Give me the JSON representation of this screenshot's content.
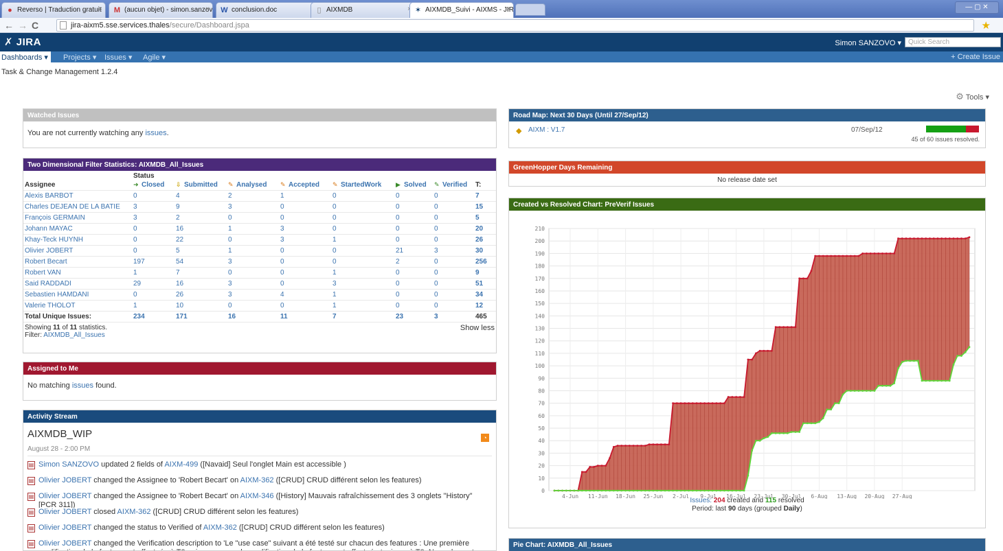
{
  "browser": {
    "tabs": [
      {
        "title": "Reverso | Traduction gratuit",
        "icon": "reverso-icon"
      },
      {
        "title": "(aucun objet) - simon.sanzov",
        "icon": "gmail-icon"
      },
      {
        "title": "conclusion.doc",
        "icon": "word-icon"
      },
      {
        "title": "AIXMDB",
        "icon": "page-icon"
      },
      {
        "title": "AIXMDB_Suivi - AIXMS - JIRA",
        "icon": "jira-icon"
      }
    ],
    "url_host": "jira-aixm5.sse.services.thales",
    "url_path": "/secure/Dashboard.jspa"
  },
  "header": {
    "logo": "JIRA",
    "user": "Simon SANZOVO",
    "search_placeholder": "Quick Search",
    "menu": {
      "dashboards": "Dashboards",
      "projects": "Projects",
      "issues": "Issues",
      "agile": "Agile"
    },
    "create": "+ Create Issue"
  },
  "dashboard": {
    "title": "Task & Change Management 1.2.4",
    "tools": "Tools"
  },
  "watched": {
    "title": "Watched Issues",
    "text_before": "You are not currently watching any",
    "link": "issues",
    "text_after": "."
  },
  "twodim": {
    "title": "Two Dimensional Filter Statistics: AIXMDB_All_Issues",
    "status_label": "Status",
    "assignee_label": "Assignee",
    "columns": [
      "Closed",
      "Submitted",
      "Analysed",
      "Accepted",
      "StartedWork",
      "Solved",
      "Verified",
      "T:"
    ],
    "rows": [
      {
        "name": "Alexis BARBOT",
        "v": [
          "0",
          "4",
          "2",
          "1",
          "0",
          "0",
          "0",
          "7"
        ]
      },
      {
        "name": "Charles DEJEAN DE LA BATIE",
        "v": [
          "3",
          "9",
          "3",
          "0",
          "0",
          "0",
          "0",
          "15"
        ]
      },
      {
        "name": "François GERMAIN",
        "v": [
          "3",
          "2",
          "0",
          "0",
          "0",
          "0",
          "0",
          "5"
        ]
      },
      {
        "name": "Johann MAYAC",
        "v": [
          "0",
          "16",
          "1",
          "3",
          "0",
          "0",
          "0",
          "20"
        ]
      },
      {
        "name": "Khay-Teck HUYNH",
        "v": [
          "0",
          "22",
          "0",
          "3",
          "1",
          "0",
          "0",
          "26"
        ]
      },
      {
        "name": "Olivier JOBERT",
        "v": [
          "0",
          "5",
          "1",
          "0",
          "0",
          "21",
          "3",
          "30"
        ]
      },
      {
        "name": "Robert Becart",
        "v": [
          "197",
          "54",
          "3",
          "0",
          "0",
          "2",
          "0",
          "256"
        ]
      },
      {
        "name": "Robert VAN",
        "v": [
          "1",
          "7",
          "0",
          "0",
          "1",
          "0",
          "0",
          "9"
        ]
      },
      {
        "name": "Said RADDADI",
        "v": [
          "29",
          "16",
          "3",
          "0",
          "3",
          "0",
          "0",
          "51"
        ]
      },
      {
        "name": "Sebastien HAMDANI",
        "v": [
          "0",
          "26",
          "3",
          "4",
          "1",
          "0",
          "0",
          "34"
        ]
      },
      {
        "name": "Valerie THOLOT",
        "v": [
          "1",
          "10",
          "0",
          "0",
          "1",
          "0",
          "0",
          "12"
        ]
      }
    ],
    "total": {
      "name": "Total Unique Issues:",
      "v": [
        "234",
        "171",
        "16",
        "11",
        "7",
        "23",
        "3",
        "465"
      ]
    },
    "showing_prefix": "Showing",
    "showing_count": "11",
    "showing_mid": "of",
    "showing_total": "11",
    "showing_suffix": "statistics.",
    "filter_label": "Filter:",
    "filter_link": "AIXMDB_All_Issues",
    "show_less": "Show less"
  },
  "assigned": {
    "title": "Assigned to Me",
    "text_before": "No matching",
    "link": "issues",
    "text_after": "found."
  },
  "activity": {
    "title": "Activity Stream",
    "project": "AIXMDB_WIP",
    "date": "August 28 - 2:00 PM",
    "items": [
      {
        "user": "Simon SANZOVO",
        "a": " updated 2 fields of ",
        "issue": "AIXM-499",
        "b": " ([Navaid] Seul l'onglet Main est accessible )"
      },
      {
        "user": "Olivier JOBERT",
        "a": " changed the Assignee to 'Robert Becart' on ",
        "issue": "AIXM-362",
        "b": " ([CRUD] CRUD différent selon les features)"
      },
      {
        "user": "Olivier JOBERT",
        "a": " changed the Assignee to 'Robert Becart' on ",
        "issue": "AIXM-346",
        "b": " ([History] Mauvais rafraîchissement des 3 onglets \"History\" [PCR 311])"
      },
      {
        "user": "Olivier JOBERT",
        "a": " closed ",
        "issue": "AIXM-362",
        "b": " ([CRUD] CRUD différent selon les features)"
      },
      {
        "user": "Olivier JOBERT",
        "a": " changed the status to Verified of ",
        "issue": "AIXM-362",
        "b": " ([CRUD] CRUD différent selon les features)"
      },
      {
        "user": "Olivier JOBERT",
        "a": " changed the Verification description to 'Le \"use case\" suivant a été testé sur chacun des features : Une première modification de la feature est effectuée à T0 puis une seconde modification de la feature est effectuée toujours à T0. Normalement, une BL est créée à chaque modification",
        "issue": "",
        "b": ""
      }
    ]
  },
  "roadmap": {
    "title": "Road Map: Next 30 Days (Until 27/Sep/12)",
    "version": "AIXM : V1.7",
    "date": "07/Sep/12",
    "resolved_text": "45 of 60 issues resolved.",
    "resolved": 45,
    "total": 60
  },
  "greenhopper": {
    "title": "GreenHopper Days Remaining",
    "text": "No release date set"
  },
  "cvr": {
    "title": "Created vs Resolved Chart: PreVerif Issues",
    "issues_label": "Issues:",
    "created": "204",
    "created_text": "created and",
    "resolved": "115",
    "resolved_text": "resolved",
    "period_label": "Period: last",
    "period_days": "90",
    "period_mid": "days (grouped",
    "period_group": "Daily",
    "period_end": ")"
  },
  "pie": {
    "title": "Pie Chart: AIXMDB_All_Issues"
  },
  "colors": {
    "watched": "#c0c0c0",
    "twodim": "#4b2a7a",
    "assigned": "#a01830",
    "activity": "#1a4b7d",
    "roadmap": "#2d5f8e",
    "greenhopper": "#d2472a",
    "cvr": "#3a6b14",
    "pie": "#2d5f8e",
    "created_line": "#c8192e",
    "resolved_line": "#5ed53a"
  },
  "chart_data": {
    "type": "area",
    "title": "",
    "xlabel": "",
    "ylabel": "",
    "ylim": [
      0,
      210
    ],
    "yticks": [
      0,
      10,
      20,
      30,
      40,
      50,
      60,
      70,
      80,
      90,
      100,
      110,
      120,
      130,
      140,
      150,
      160,
      170,
      180,
      190,
      200,
      210
    ],
    "xticks": [
      "4-Jun",
      "11-Jun",
      "18-Jun",
      "25-Jun",
      "2-Jul",
      "9-Jul",
      "16-Jul",
      "23-Jul",
      "30-Jul",
      "6-Aug",
      "13-Aug",
      "20-Aug",
      "27-Aug"
    ],
    "grid": true,
    "start_date": "31-May",
    "series": [
      {
        "name": "",
        "values": [
          0,
          0,
          0,
          0,
          0,
          0,
          0,
          15,
          15,
          19,
          19,
          20,
          20,
          20,
          26,
          35,
          36,
          36,
          36,
          36,
          36,
          36,
          36,
          36,
          37,
          37,
          37,
          37,
          37,
          37,
          70,
          70,
          70,
          70,
          70,
          70,
          70,
          70,
          70,
          70,
          70,
          70,
          70,
          70,
          75,
          75,
          75,
          75,
          75,
          105,
          105,
          110,
          112,
          112,
          112,
          112,
          131,
          131,
          131,
          131,
          131,
          131,
          170,
          170,
          170,
          176,
          188,
          188,
          188,
          188,
          188,
          188,
          188,
          188,
          188,
          188,
          188,
          188,
          190,
          190,
          190,
          190,
          190,
          190,
          190,
          190,
          190,
          202,
          202,
          202,
          202,
          202,
          202,
          202,
          202,
          202,
          202,
          202,
          202,
          202,
          202,
          202,
          202,
          202,
          202,
          203
        ]
      },
      {
        "name": "",
        "values": [
          0,
          0,
          0,
          0,
          0,
          0,
          0,
          0,
          0,
          0,
          0,
          0,
          0,
          0,
          0,
          0,
          0,
          0,
          0,
          0,
          0,
          0,
          0,
          0,
          0,
          0,
          0,
          0,
          0,
          0,
          0,
          0,
          0,
          0,
          0,
          0,
          0,
          0,
          0,
          0,
          0,
          0,
          0,
          0,
          0,
          0,
          0,
          0,
          0,
          12,
          32,
          40,
          40,
          42,
          43,
          46,
          46,
          46,
          46,
          46,
          47,
          47,
          47,
          54,
          54,
          54,
          54,
          55,
          58,
          65,
          65,
          70,
          70,
          77,
          80,
          80,
          80,
          80,
          80,
          80,
          80,
          80,
          84,
          84,
          84,
          84,
          86,
          98,
          103,
          104,
          104,
          104,
          104,
          88,
          88,
          88,
          88,
          88,
          88,
          88,
          88,
          101,
          108,
          108,
          111,
          115
        ]
      }
    ]
  }
}
